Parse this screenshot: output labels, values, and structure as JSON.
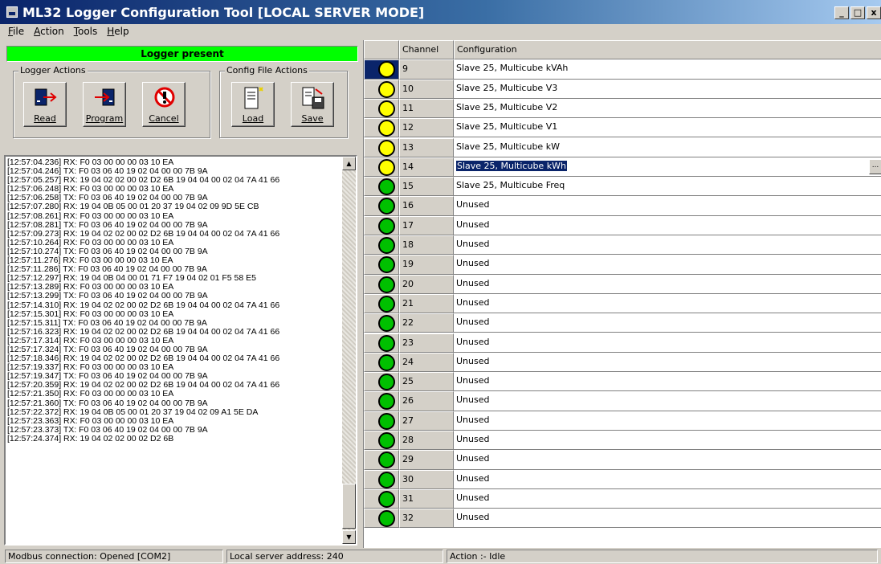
{
  "window": {
    "title": "ML32 Logger Configuration Tool [LOCAL SERVER MODE]",
    "min": "_",
    "max": "□",
    "close": "x"
  },
  "menu": [
    {
      "first": "F",
      "rest": "ile"
    },
    {
      "first": "A",
      "rest": "ction"
    },
    {
      "first": "T",
      "rest": "ools"
    },
    {
      "first": "H",
      "rest": "elp"
    }
  ],
  "banner": "Logger present",
  "logger_actions": {
    "title": "Logger Actions",
    "read": "Read",
    "program": "Program",
    "cancel": "Cancel"
  },
  "config_actions": {
    "title": "Config File Actions",
    "load": "Load",
    "save": "Save"
  },
  "log": [
    "[12:57:04.236] RX: F0 03 00 00 00 03 10 EA",
    "[12:57:04.246] TX: F0 03 06 40 19 02 04 00 00 7B 9A",
    "[12:57:05.257] RX: 19 04 02 02 00 02 D2 6B 19 04 04 00 02 04 7A 41 66",
    "[12:57:06.248] RX: F0 03 00 00 00 03 10 EA",
    "[12:57:06.258] TX: F0 03 06 40 19 02 04 00 00 7B 9A",
    "[12:57:07.280] RX: 19 04 0B 05 00 01 20 37 19 04 02 09 9D 5E CB",
    "[12:57:08.261] RX: F0 03 00 00 00 03 10 EA",
    "[12:57:08.281] TX: F0 03 06 40 19 02 04 00 00 7B 9A",
    "[12:57:09.273] RX: 19 04 02 02 00 02 D2 6B 19 04 04 00 02 04 7A 41 66",
    "[12:57:10.264] RX: F0 03 00 00 00 03 10 EA",
    "[12:57:10.274] TX: F0 03 06 40 19 02 04 00 00 7B 9A",
    "[12:57:11.276] RX: F0 03 00 00 00 03 10 EA",
    "[12:57:11.286] TX: F0 03 06 40 19 02 04 00 00 7B 9A",
    "[12:57:12.297] RX: 19 04 0B 04 00 01 71 F7 19 04 02 01 F5 58 E5",
    "[12:57:13.289] RX: F0 03 00 00 00 03 10 EA",
    "[12:57:13.299] TX: F0 03 06 40 19 02 04 00 00 7B 9A",
    "[12:57:14.310] RX: 19 04 02 02 00 02 D2 6B 19 04 04 00 02 04 7A 41 66",
    "[12:57:15.301] RX: F0 03 00 00 00 03 10 EA",
    "[12:57:15.311] TX: F0 03 06 40 19 02 04 00 00 7B 9A",
    "[12:57:16.323] RX: 19 04 02 02 00 02 D2 6B 19 04 04 00 02 04 7A 41 66",
    "[12:57:17.314] RX: F0 03 00 00 00 03 10 EA",
    "[12:57:17.324] TX: F0 03 06 40 19 02 04 00 00 7B 9A",
    "[12:57:18.346] RX: 19 04 02 02 00 02 D2 6B 19 04 04 00 02 04 7A 41 66",
    "[12:57:19.337] RX: F0 03 00 00 00 03 10 EA",
    "[12:57:19.347] TX: F0 03 06 40 19 02 04 00 00 7B 9A",
    "[12:57:20.359] RX: 19 04 02 02 00 02 D2 6B 19 04 04 00 02 04 7A 41 66",
    "[12:57:21.350] RX: F0 03 00 00 00 03 10 EA",
    "[12:57:21.360] TX: F0 03 06 40 19 02 04 00 00 7B 9A",
    "[12:57:22.372] RX: 19 04 0B 05 00 01 20 37 19 04 02 09 A1 5E DA",
    "[12:57:23.363] RX: F0 03 00 00 00 03 10 EA",
    "[12:57:23.373] TX: F0 03 06 40 19 02 04 00 00 7B 9A",
    "[12:57:24.374] RX: 19 04 02 02 00 02 D2 6B"
  ],
  "grid": {
    "headers": {
      "channel": "Channel",
      "configuration": "Configuration"
    },
    "rows": [
      {
        "channel": "9",
        "config": "Slave 25, Multicube kVAh",
        "status": "yellow",
        "current": true
      },
      {
        "channel": "10",
        "config": "Slave 25, Multicube V3",
        "status": "yellow"
      },
      {
        "channel": "11",
        "config": "Slave 25, Multicube V2",
        "status": "yellow"
      },
      {
        "channel": "12",
        "config": "Slave 25, Multicube V1",
        "status": "yellow"
      },
      {
        "channel": "13",
        "config": "Slave 25, Multicube kW",
        "status": "yellow"
      },
      {
        "channel": "14",
        "config": "Slave 25, Multicube kWh",
        "status": "yellow",
        "selected": true
      },
      {
        "channel": "15",
        "config": "Slave 25, Multicube Freq",
        "status": "green"
      },
      {
        "channel": "16",
        "config": "Unused",
        "status": "green"
      },
      {
        "channel": "17",
        "config": "Unused",
        "status": "green"
      },
      {
        "channel": "18",
        "config": "Unused",
        "status": "green"
      },
      {
        "channel": "19",
        "config": "Unused",
        "status": "green"
      },
      {
        "channel": "20",
        "config": "Unused",
        "status": "green"
      },
      {
        "channel": "21",
        "config": "Unused",
        "status": "green"
      },
      {
        "channel": "22",
        "config": "Unused",
        "status": "green"
      },
      {
        "channel": "23",
        "config": "Unused",
        "status": "green"
      },
      {
        "channel": "24",
        "config": "Unused",
        "status": "green"
      },
      {
        "channel": "25",
        "config": "Unused",
        "status": "green"
      },
      {
        "channel": "26",
        "config": "Unused",
        "status": "green"
      },
      {
        "channel": "27",
        "config": "Unused",
        "status": "green"
      },
      {
        "channel": "28",
        "config": "Unused",
        "status": "green"
      },
      {
        "channel": "29",
        "config": "Unused",
        "status": "green"
      },
      {
        "channel": "30",
        "config": "Unused",
        "status": "green"
      },
      {
        "channel": "31",
        "config": "Unused",
        "status": "green"
      },
      {
        "channel": "32",
        "config": "Unused",
        "status": "green"
      }
    ],
    "ellipsis": "..."
  },
  "status": {
    "modbus": "Modbus connection: Opened [COM2]",
    "address": "Local server address: 240",
    "action": "Action :- Idle"
  },
  "colors": {
    "banner": "#00ff00",
    "title_bar": "#0a246a",
    "status_green": "#00c000",
    "status_yellow": "#ffff00",
    "selection": "#0a246a"
  }
}
